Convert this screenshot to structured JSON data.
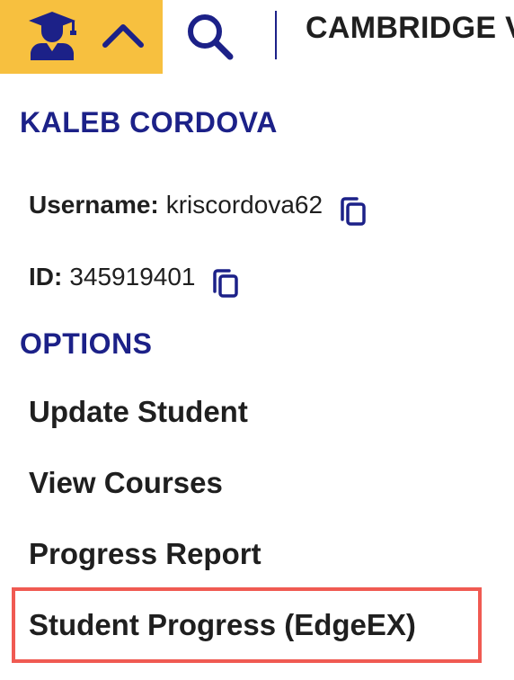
{
  "topbar": {
    "site_title": "CAMBRIDGE V",
    "accent_color": "#f7c03f",
    "icons": {
      "student": "graduate-student-icon",
      "toggle": "chevron-up-icon",
      "search": "search-icon"
    }
  },
  "student": {
    "name": "KALEB CORDOVA",
    "username_label": "Username:",
    "username_value": "kriscordova62",
    "id_label": "ID:",
    "id_value": "345919401"
  },
  "options": {
    "heading": "OPTIONS",
    "items": [
      {
        "label": "Update Student"
      },
      {
        "label": "View Courses"
      },
      {
        "label": "Progress Report"
      },
      {
        "label": "Student Progress (EdgeEX)",
        "highlighted": true
      }
    ]
  },
  "colors": {
    "heading": "#1c2188",
    "text": "#1f1f1f",
    "highlight_border": "#f05a52"
  }
}
